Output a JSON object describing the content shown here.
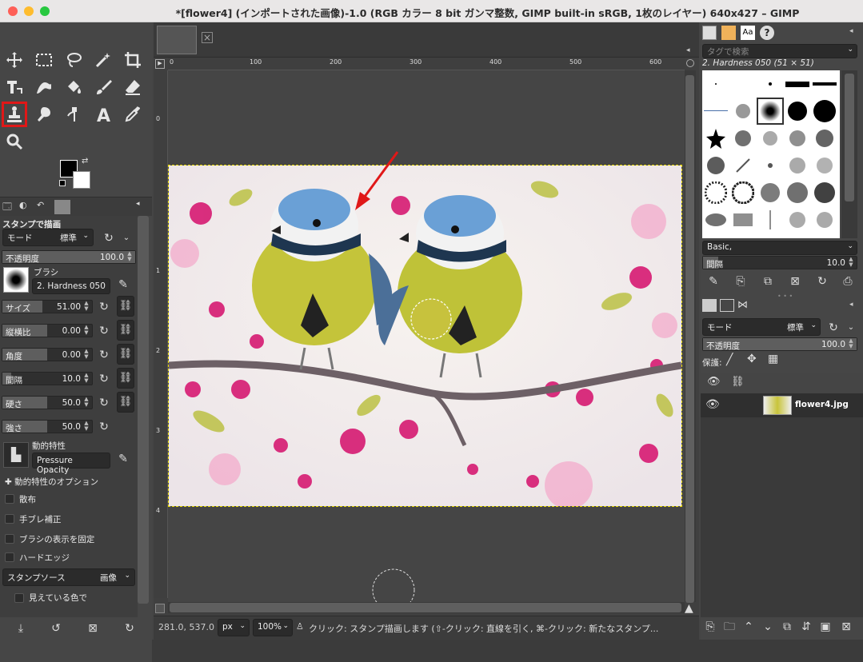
{
  "window": {
    "title": "*[flower4] (インポートされた画像)-1.0 (RGB カラー 8 bit ガンマ整数, GIMP built-in sRGB, 1枚のレイヤー) 640x427 – GIMP"
  },
  "tool_options": {
    "title": "スタンプで描画",
    "mode_label": "モード",
    "mode_value": "標準",
    "opacity_label": "不透明度",
    "opacity_value": "100.0",
    "opacity_fraction": 1.0,
    "brush_label": "ブラシ",
    "brush_name": "2. Hardness 050",
    "size_label": "サイズ",
    "size_value": "51.00",
    "aspect_label": "縦横比",
    "aspect_value": "0.00",
    "angle_label": "角度",
    "angle_value": "0.00",
    "spacing_label": "間隔",
    "spacing_value": "10.0",
    "hardness_label": "硬さ",
    "hardness_value": "50.0",
    "force_label": "強さ",
    "force_value": "50.0",
    "dynamics_label": "動的特性",
    "dynamics_name": "Pressure Opacity",
    "dynamics_options": "動的特性のオプション",
    "scatter": "散布",
    "smooth": "手ブレ補正",
    "lock_brush": "ブラシの表示を固定",
    "hard_edge": "ハードエッジ",
    "source_label": "スタンプソース",
    "source_value": "画像",
    "sample_merged": "見えている色で"
  },
  "status": {
    "coords": "281.0, 537.0",
    "unit": "px",
    "zoom": "100%",
    "message": "クリック: スタンプ描画します (⇧-クリック: 直線を引く, ⌘-クリック: 新たなスタンプ..."
  },
  "ruler": {
    "h_ticks": [
      "0",
      "100",
      "200",
      "300",
      "400",
      "500",
      "600"
    ],
    "v_ticks": [
      "0",
      "1",
      "2",
      "3",
      "4"
    ]
  },
  "brushes": {
    "search_placeholder": "タグで検索",
    "selected": "2. Hardness 050 (51 × 51)",
    "tag": "Basic,",
    "spacing_label": "間隔",
    "spacing_value": "10.0"
  },
  "layers": {
    "mode_label": "モード",
    "mode_value": "標準",
    "opacity_label": "不透明度",
    "opacity_value": "100.0",
    "lock_label": "保護:",
    "layer_name": "flower4.jpg"
  },
  "colors": {
    "accent_red": "#e01818",
    "selection": "#e6d600"
  }
}
